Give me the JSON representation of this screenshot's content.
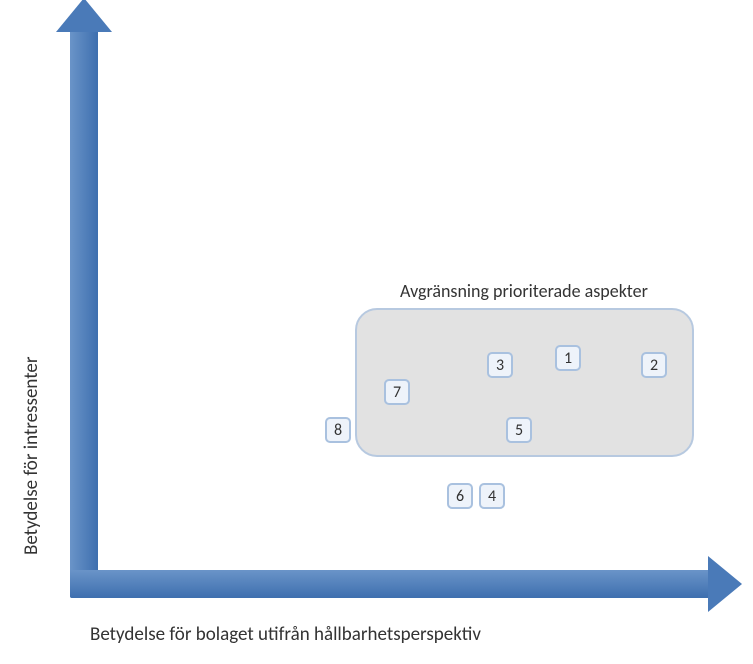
{
  "chart_data": {
    "type": "scatter",
    "title": "",
    "xlabel": "Betydelse för bolaget utifrån hållbarhetsperspektiv",
    "ylabel": "Betydelse för intressenter",
    "xlim": [
      0,
      10
    ],
    "ylim": [
      0,
      10
    ],
    "region_label": "Avgränsning prioriterade aspekter",
    "region": {
      "x0": 4.4,
      "y0": 2.1,
      "x1": 9.6,
      "y1": 4.7
    },
    "points": [
      {
        "id": "1",
        "x": 7.6,
        "y": 3.9,
        "in_region": true
      },
      {
        "id": "2",
        "x": 9.0,
        "y": 3.7,
        "in_region": true
      },
      {
        "id": "3",
        "x": 6.5,
        "y": 3.7,
        "in_region": true
      },
      {
        "id": "4",
        "x": 6.4,
        "y": 1.5,
        "in_region": false
      },
      {
        "id": "5",
        "x": 6.8,
        "y": 2.6,
        "in_region": true
      },
      {
        "id": "6",
        "x": 5.9,
        "y": 1.5,
        "in_region": false
      },
      {
        "id": "7",
        "x": 4.9,
        "y": 3.3,
        "in_region": true
      },
      {
        "id": "8",
        "x": 4.0,
        "y": 2.6,
        "in_region": false
      }
    ]
  }
}
